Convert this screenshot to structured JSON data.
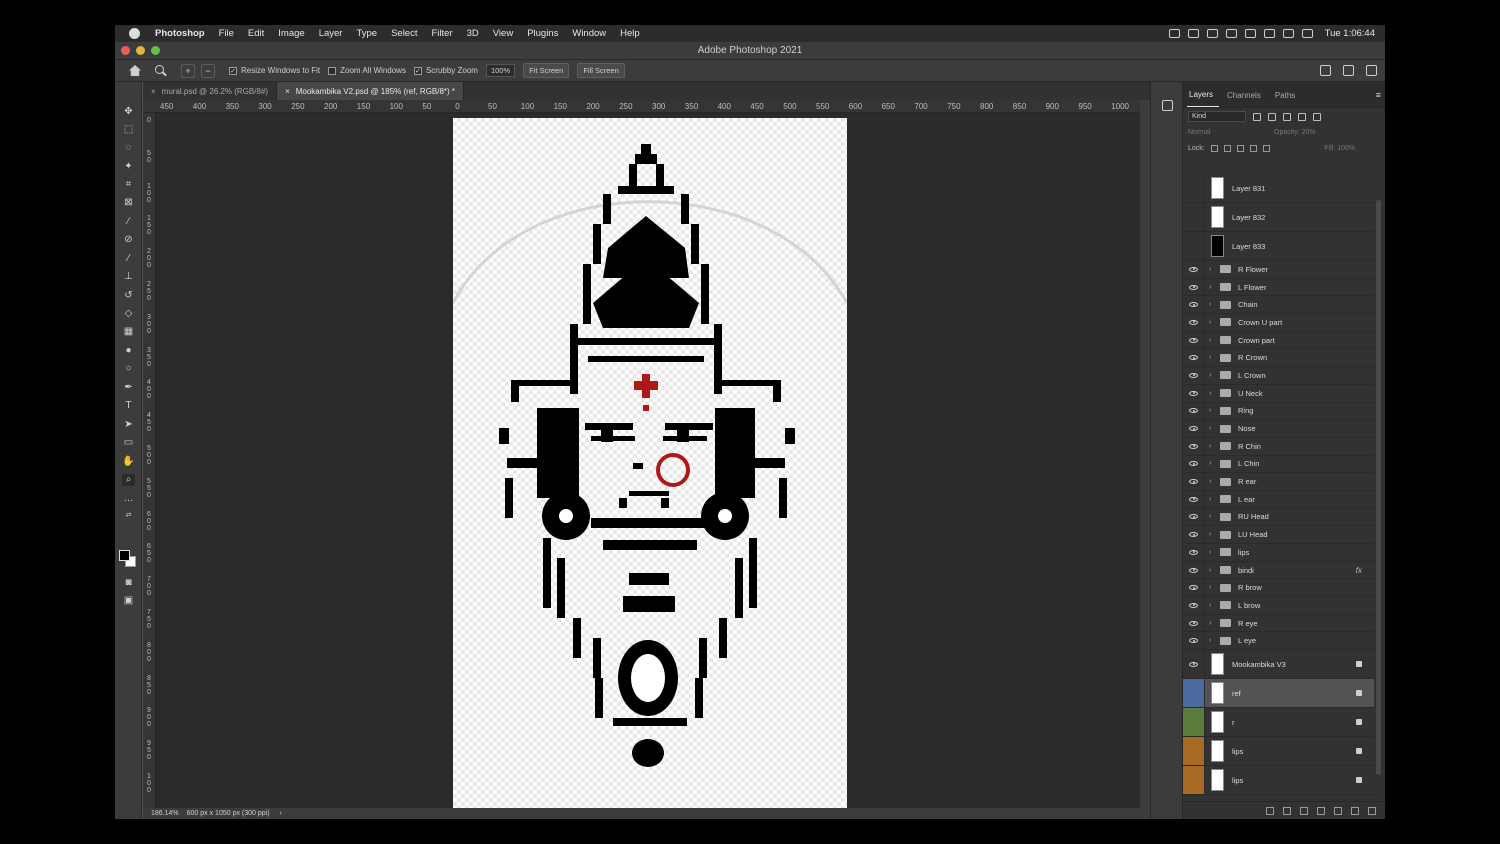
{
  "menubar": {
    "app": "Photoshop",
    "items": [
      "File",
      "Edit",
      "Image",
      "Layer",
      "Type",
      "Select",
      "Filter",
      "3D",
      "View",
      "Plugins",
      "Window",
      "Help"
    ],
    "clock": "Tue 1:06:44"
  },
  "window": {
    "title": "Adobe Photoshop 2021"
  },
  "options": {
    "resize_label": "Resize Windows to Fit",
    "zoom_all_label": "Zoom All Windows",
    "scrubby_label": "Scrubby Zoom",
    "zoom_value": "100%",
    "fit_screen": "Fit Screen",
    "fill_screen": "Fill Screen"
  },
  "tabs": [
    {
      "label": "mural.psd @ 26.2% (RGB/8#)"
    },
    {
      "label": "Mookambika V2.psd @ 185% (ref, RGB/8*) *"
    }
  ],
  "ruler": {
    "h_ticks": [
      "450",
      "400",
      "350",
      "300",
      "250",
      "200",
      "150",
      "100",
      "50",
      "0",
      "50",
      "100",
      "150",
      "200",
      "250",
      "300",
      "350",
      "400",
      "450",
      "500",
      "550",
      "600",
      "650",
      "700",
      "750",
      "800",
      "850",
      "900",
      "950",
      "1000"
    ],
    "v_ticks": [
      "0",
      "5 0",
      "1 0 0",
      "1 5 0",
      "2 0 0",
      "2 5 0",
      "3 0 0",
      "3 5 0",
      "4 0 0",
      "4 5 0",
      "5 0 0",
      "5 5 0",
      "6 0 0",
      "6 5 0",
      "7 0 0",
      "7 5 0",
      "8 0 0",
      "8 5 0",
      "9 0 0",
      "9 5 0",
      "1 0 0"
    ]
  },
  "status": {
    "zoom": "186.14%",
    "doc_size": "600 px x 1050 px (300 ppi)"
  },
  "panel": {
    "tabs": [
      "Layers",
      "Channels",
      "Paths"
    ],
    "kind_label": "Kind",
    "blend_mode": "Normal",
    "opacity_label": "Opacity:",
    "opacity_value": "20%",
    "lock_label": "Lock:",
    "fill_label": "Fill:",
    "fill_value": "100%"
  },
  "layers": [
    {
      "name": "Layer 831",
      "type": "pixel",
      "visible": false,
      "thumb": "white"
    },
    {
      "name": "Layer 832",
      "type": "pixel",
      "visible": false,
      "thumb": "white"
    },
    {
      "name": "Layer 833",
      "type": "pixel",
      "visible": false,
      "thumb": "black"
    },
    {
      "name": "R Flower",
      "type": "group",
      "visible": true
    },
    {
      "name": "L Flower",
      "type": "group",
      "visible": true
    },
    {
      "name": "Chain",
      "type": "group",
      "visible": true
    },
    {
      "name": "Crown U part",
      "type": "group",
      "visible": true
    },
    {
      "name": "Crown part",
      "type": "group",
      "visible": true
    },
    {
      "name": "R Crown",
      "type": "group",
      "visible": true
    },
    {
      "name": "L Crown",
      "type": "group",
      "visible": true
    },
    {
      "name": "U Neck",
      "type": "group",
      "visible": true
    },
    {
      "name": "Ring",
      "type": "group",
      "visible": true
    },
    {
      "name": "Nose",
      "type": "group",
      "visible": true
    },
    {
      "name": "R Chin",
      "type": "group",
      "visible": true
    },
    {
      "name": "L Chin",
      "type": "group",
      "visible": true
    },
    {
      "name": "R ear",
      "type": "group",
      "visible": true
    },
    {
      "name": "L ear",
      "type": "group",
      "visible": true
    },
    {
      "name": "RU Head",
      "type": "group",
      "visible": true
    },
    {
      "name": "LU Head",
      "type": "group",
      "visible": true
    },
    {
      "name": "lips",
      "type": "group",
      "visible": true
    },
    {
      "name": "bindi",
      "type": "group",
      "visible": true,
      "fx": "fx"
    },
    {
      "name": "R brow",
      "type": "group",
      "visible": true
    },
    {
      "name": "L brow",
      "type": "group",
      "visible": true
    },
    {
      "name": "R eye",
      "type": "group",
      "visible": true
    },
    {
      "name": "L eye",
      "type": "group",
      "visible": true
    },
    {
      "name": "Mookambika V3",
      "type": "pixel",
      "visible": true,
      "locked": true,
      "thumb": "white"
    },
    {
      "name": "ref",
      "type": "pixel",
      "visible": false,
      "locked": true,
      "thumb": "white",
      "selected": true,
      "color": "#4a6aa0"
    },
    {
      "name": "r",
      "type": "pixel",
      "visible": false,
      "locked": true,
      "thumb": "white",
      "color": "#5b7c3a"
    },
    {
      "name": "lips",
      "type": "pixel",
      "visible": false,
      "locked": true,
      "thumb": "white",
      "color": "#a86a24"
    },
    {
      "name": "lips",
      "type": "pixel",
      "visible": false,
      "locked": true,
      "thumb": "white",
      "color": "#a86a24"
    }
  ],
  "colors": {
    "accent_red": "#b01818",
    "canvas_bg": "#2b2b2b",
    "panel_bg": "#323232"
  }
}
